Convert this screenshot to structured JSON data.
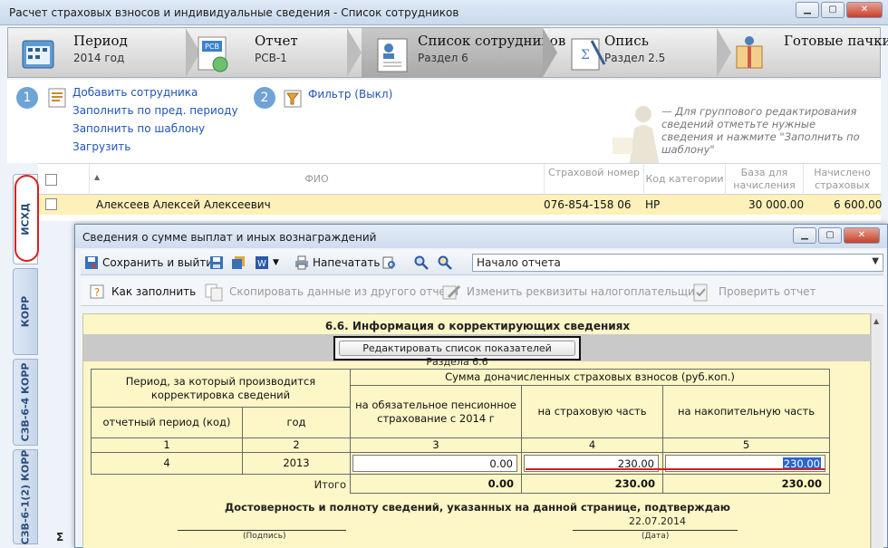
{
  "window": {
    "title": "Расчет страховых взносов и индивидуальные сведения - Список сотрудников"
  },
  "steps": [
    {
      "name": "Период",
      "sub": "2014 год"
    },
    {
      "name": "Отчет",
      "sub": "РСВ-1"
    },
    {
      "name": "Список сотрудников",
      "sub": "Раздел 6"
    },
    {
      "name": "Опись",
      "sub": "Раздел 2.5"
    },
    {
      "name": "Готовые пачки",
      "sub": ""
    }
  ],
  "actions": {
    "badge1": "1",
    "badge2": "2",
    "add_employee": "Добавить сотрудника",
    "fill_prev": "Заполнить по пред. периоду",
    "fill_template": "Заполнить по шаблону",
    "load": "Загрузить",
    "filter": "Фильтр (Выкл)",
    "hint": "— Для группового редактирования сведений отметьте нужные сведения и нажмите \"Заполнить по шаблону\""
  },
  "grid": {
    "headers": {
      "fio": "ФИО",
      "snils": "Страховой номер",
      "category": "Код категории",
      "base": "База для начисления взносов",
      "charged": "Начислено страховых взносов"
    },
    "row": {
      "fio": "Алексеев Алексей Алексеевич",
      "snils": "076-854-158 06",
      "category": "НР",
      "base": "30 000.00",
      "charged": "6 600.00"
    }
  },
  "tabs": [
    "ИСХД",
    "КОРР",
    "СЗВ-6-4 КОРР",
    "СЗВ-6-1(2) КОРР"
  ],
  "sigma": "Σ",
  "dialog": {
    "title": "Сведения о сумме выплат и иных вознаграждений",
    "save_exit": "Сохранить и выйти",
    "print": "Напечатать",
    "nav_select": "Начало отчета",
    "how_to_fill": "Как заполнить",
    "copy_from_other": "Скопировать данные из другого отчета",
    "change_details": "Изменить реквизиты налогоплательщика",
    "check_report": "Проверить отчет"
  },
  "form": {
    "section_title": "6.6. Информация о корректирующих сведениях",
    "edit_button": "Редактировать список показателей Раздела 6.6",
    "head_period": "Период, за который производится корректировка сведений",
    "head_sum": "Сумма доначисленных страховых взносов (руб.коп.)",
    "head_period_code": "отчетный период (код)",
    "head_year": "год",
    "head_ops": "на обязательное пенсионное страхование с 2014 г",
    "head_insurance": "на страховую часть",
    "head_funded": "на накопительную часть",
    "col_nums": [
      "1",
      "2",
      "3",
      "4",
      "5"
    ],
    "row": {
      "period_code": "4",
      "year": "2013",
      "ops": "0.00",
      "insurance": "230.00",
      "funded": "230.00"
    },
    "total_label": "Итого",
    "totals": {
      "ops": "0.00",
      "insurance": "230.00",
      "funded": "230.00"
    },
    "confirm_text": "Достоверность и полноту сведений, указанных на данной странице, подтверждаю",
    "date": "22.07.2014",
    "signature_label": "(Подпись)",
    "date_label": "(Дата)"
  }
}
